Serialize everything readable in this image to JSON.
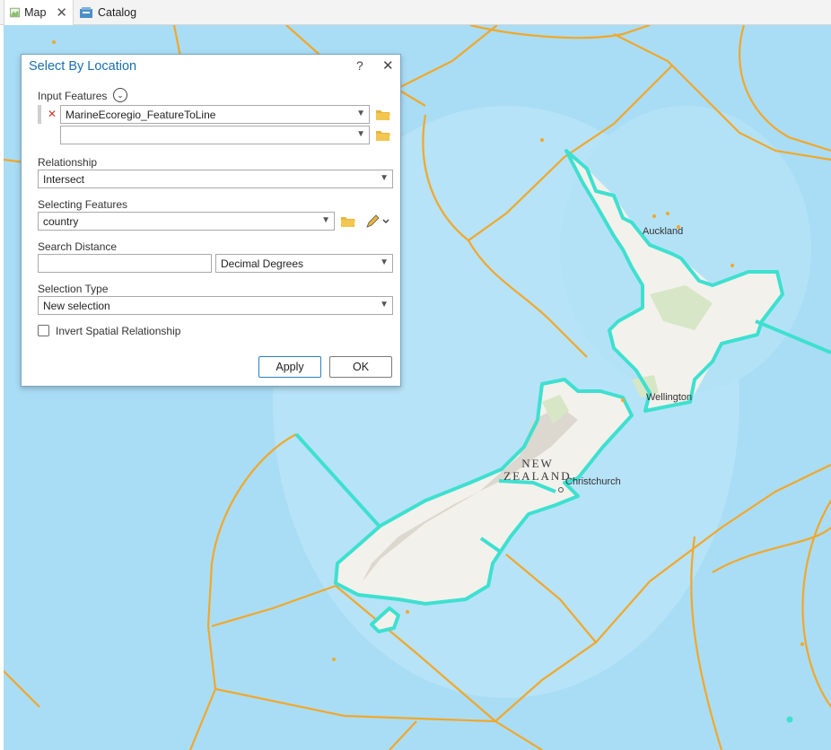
{
  "tabs": [
    {
      "label": "Map",
      "icon": "map-icon",
      "close": "✕"
    },
    {
      "label": "Catalog",
      "icon": "catalog-icon"
    }
  ],
  "map": {
    "labels": {
      "auckland": "Auckland",
      "wellington": "Wellington",
      "christchurch": "Christchurch",
      "country_line1": "NEW",
      "country_line2": "ZEALAND"
    },
    "colors": {
      "ocean": "#a9ddf5",
      "ecoregion_lines": "#f2a72a",
      "selected_outline": "#3ee0d0",
      "land": "#f3f1ec"
    }
  },
  "dialog": {
    "title": "Select By Location",
    "help": "?",
    "close": "✕",
    "input_features": {
      "label": "Input Features",
      "values": [
        "MarineEcoregio_FeatureToLine",
        ""
      ]
    },
    "relationship": {
      "label": "Relationship",
      "value": "Intersect"
    },
    "selecting_features": {
      "label": "Selecting Features",
      "value": "country"
    },
    "search_distance": {
      "label": "Search Distance",
      "value": "",
      "unit": "Decimal Degrees"
    },
    "selection_type": {
      "label": "Selection Type",
      "value": "New selection"
    },
    "invert": {
      "label": "Invert Spatial Relationship",
      "checked": false
    },
    "buttons": {
      "apply": "Apply",
      "ok": "OK"
    },
    "colors": {
      "title": "#1a6fb0",
      "accent": "#2d7fc1"
    }
  }
}
